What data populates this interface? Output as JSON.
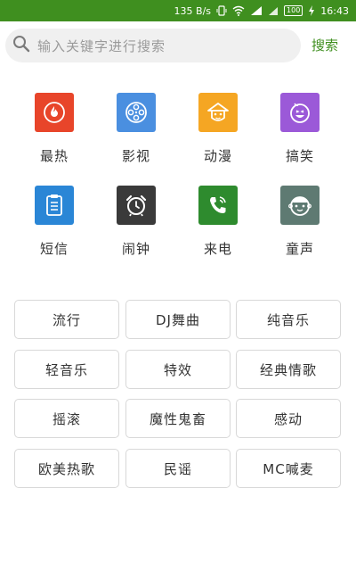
{
  "status_bar": {
    "speed": "135 B/s",
    "battery": "100",
    "time": "16:43"
  },
  "search": {
    "placeholder": "输入关键字进行搜索",
    "button_label": "搜索"
  },
  "categories": [
    {
      "label": "最热",
      "color": "#e8452a",
      "icon": "fire-icon"
    },
    {
      "label": "影视",
      "color": "#4a8fe0",
      "icon": "film-reel-icon"
    },
    {
      "label": "动漫",
      "color": "#f5a623",
      "icon": "anime-character-icon"
    },
    {
      "label": "搞笑",
      "color": "#9b59d8",
      "icon": "smiley-face-icon"
    },
    {
      "label": "短信",
      "color": "#2a86d6",
      "icon": "message-document-icon"
    },
    {
      "label": "闹钟",
      "color": "#3a3a3a",
      "icon": "alarm-clock-icon"
    },
    {
      "label": "来电",
      "color": "#2e8b2e",
      "icon": "phone-ringing-icon"
    },
    {
      "label": "童声",
      "color": "#5e7a72",
      "icon": "child-face-icon"
    }
  ],
  "genres": [
    "流行",
    "DJ舞曲",
    "纯音乐",
    "轻音乐",
    "特效",
    "经典情歌",
    "摇滚",
    "魔性鬼畜",
    "感动",
    "欧美热歌",
    "民谣",
    "MC喊麦"
  ]
}
